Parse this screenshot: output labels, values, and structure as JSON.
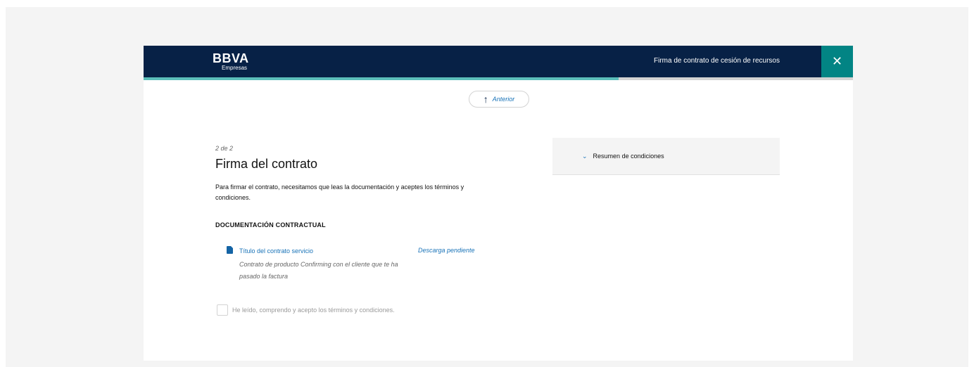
{
  "header": {
    "brand": "BBVA",
    "brand_sub": "Empresas",
    "flow_title": "Firma de contrato de cesión de recursos",
    "close_glyph": "✕"
  },
  "progress": {
    "fraction": 0.67
  },
  "nav": {
    "previous_label": "Anterior"
  },
  "step": {
    "indicator": "2 de 2"
  },
  "main": {
    "title": "Firma del contrato",
    "description": "Para firmar el contrato, necesitamos que leas la documentación y aceptes los términos y condiciones.",
    "section_title": "DOCUMENTACIÓN CONTRACTUAL"
  },
  "document": {
    "title": "Título del contrato servicio",
    "description": "Contrato de producto Confirming con el cliente que te ha pasado la factura",
    "status": "Descarga pendiente"
  },
  "terms": {
    "label": "He leído, comprendo y acepto los términos y condiciones."
  },
  "summary": {
    "label": "Resumen de condiciones"
  },
  "colors": {
    "navy": "#072146",
    "teal": "#028484",
    "progress": "#5bbeba",
    "link": "#1973b8"
  },
  "icons": {
    "close": "close-icon",
    "previous": "arrow-up-icon",
    "document": "pdf-document-icon",
    "summary": "chevron-down-icon"
  }
}
